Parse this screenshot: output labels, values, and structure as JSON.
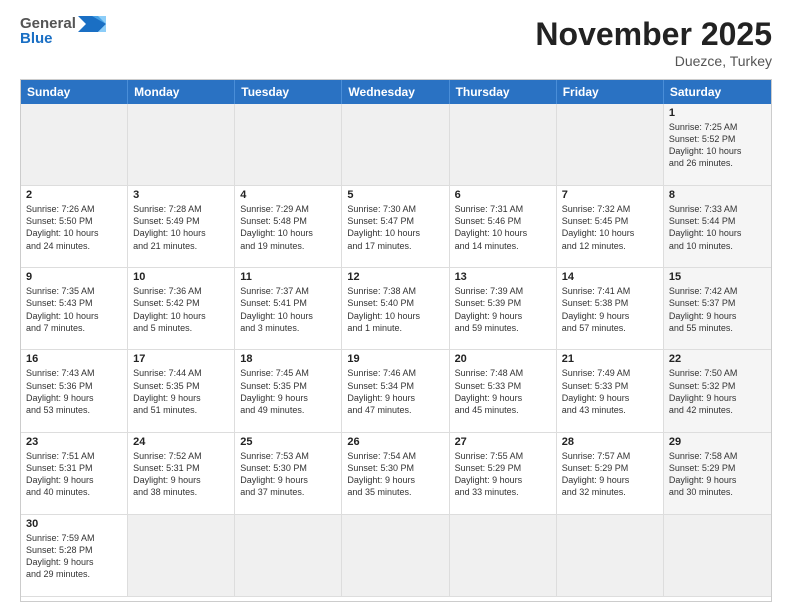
{
  "logo": {
    "general": "General",
    "blue": "Blue"
  },
  "title": "November 2025",
  "subtitle": "Duezce, Turkey",
  "weekdays": [
    "Sunday",
    "Monday",
    "Tuesday",
    "Wednesday",
    "Thursday",
    "Friday",
    "Saturday"
  ],
  "cells": [
    {
      "day": "",
      "info": "",
      "empty": true
    },
    {
      "day": "",
      "info": "",
      "empty": true
    },
    {
      "day": "",
      "info": "",
      "empty": true
    },
    {
      "day": "",
      "info": "",
      "empty": true
    },
    {
      "day": "",
      "info": "",
      "empty": true
    },
    {
      "day": "",
      "info": "",
      "empty": true
    },
    {
      "day": "1",
      "info": "Sunrise: 7:25 AM\nSunset: 5:52 PM\nDaylight: 10 hours\nand 26 minutes.",
      "shaded": true
    },
    {
      "day": "2",
      "info": "Sunrise: 7:26 AM\nSunset: 5:50 PM\nDaylight: 10 hours\nand 24 minutes.",
      "shaded": false
    },
    {
      "day": "3",
      "info": "Sunrise: 7:28 AM\nSunset: 5:49 PM\nDaylight: 10 hours\nand 21 minutes.",
      "shaded": false
    },
    {
      "day": "4",
      "info": "Sunrise: 7:29 AM\nSunset: 5:48 PM\nDaylight: 10 hours\nand 19 minutes.",
      "shaded": false
    },
    {
      "day": "5",
      "info": "Sunrise: 7:30 AM\nSunset: 5:47 PM\nDaylight: 10 hours\nand 17 minutes.",
      "shaded": false
    },
    {
      "day": "6",
      "info": "Sunrise: 7:31 AM\nSunset: 5:46 PM\nDaylight: 10 hours\nand 14 minutes.",
      "shaded": false
    },
    {
      "day": "7",
      "info": "Sunrise: 7:32 AM\nSunset: 5:45 PM\nDaylight: 10 hours\nand 12 minutes.",
      "shaded": false
    },
    {
      "day": "8",
      "info": "Sunrise: 7:33 AM\nSunset: 5:44 PM\nDaylight: 10 hours\nand 10 minutes.",
      "shaded": true
    },
    {
      "day": "9",
      "info": "Sunrise: 7:35 AM\nSunset: 5:43 PM\nDaylight: 10 hours\nand 7 minutes.",
      "shaded": false
    },
    {
      "day": "10",
      "info": "Sunrise: 7:36 AM\nSunset: 5:42 PM\nDaylight: 10 hours\nand 5 minutes.",
      "shaded": false
    },
    {
      "day": "11",
      "info": "Sunrise: 7:37 AM\nSunset: 5:41 PM\nDaylight: 10 hours\nand 3 minutes.",
      "shaded": false
    },
    {
      "day": "12",
      "info": "Sunrise: 7:38 AM\nSunset: 5:40 PM\nDaylight: 10 hours\nand 1 minute.",
      "shaded": false
    },
    {
      "day": "13",
      "info": "Sunrise: 7:39 AM\nSunset: 5:39 PM\nDaylight: 9 hours\nand 59 minutes.",
      "shaded": false
    },
    {
      "day": "14",
      "info": "Sunrise: 7:41 AM\nSunset: 5:38 PM\nDaylight: 9 hours\nand 57 minutes.",
      "shaded": false
    },
    {
      "day": "15",
      "info": "Sunrise: 7:42 AM\nSunset: 5:37 PM\nDaylight: 9 hours\nand 55 minutes.",
      "shaded": true
    },
    {
      "day": "16",
      "info": "Sunrise: 7:43 AM\nSunset: 5:36 PM\nDaylight: 9 hours\nand 53 minutes.",
      "shaded": false
    },
    {
      "day": "17",
      "info": "Sunrise: 7:44 AM\nSunset: 5:35 PM\nDaylight: 9 hours\nand 51 minutes.",
      "shaded": false
    },
    {
      "day": "18",
      "info": "Sunrise: 7:45 AM\nSunset: 5:35 PM\nDaylight: 9 hours\nand 49 minutes.",
      "shaded": false
    },
    {
      "day": "19",
      "info": "Sunrise: 7:46 AM\nSunset: 5:34 PM\nDaylight: 9 hours\nand 47 minutes.",
      "shaded": false
    },
    {
      "day": "20",
      "info": "Sunrise: 7:48 AM\nSunset: 5:33 PM\nDaylight: 9 hours\nand 45 minutes.",
      "shaded": false
    },
    {
      "day": "21",
      "info": "Sunrise: 7:49 AM\nSunset: 5:33 PM\nDaylight: 9 hours\nand 43 minutes.",
      "shaded": false
    },
    {
      "day": "22",
      "info": "Sunrise: 7:50 AM\nSunset: 5:32 PM\nDaylight: 9 hours\nand 42 minutes.",
      "shaded": true
    },
    {
      "day": "23",
      "info": "Sunrise: 7:51 AM\nSunset: 5:31 PM\nDaylight: 9 hours\nand 40 minutes.",
      "shaded": false
    },
    {
      "day": "24",
      "info": "Sunrise: 7:52 AM\nSunset: 5:31 PM\nDaylight: 9 hours\nand 38 minutes.",
      "shaded": false
    },
    {
      "day": "25",
      "info": "Sunrise: 7:53 AM\nSunset: 5:30 PM\nDaylight: 9 hours\nand 37 minutes.",
      "shaded": false
    },
    {
      "day": "26",
      "info": "Sunrise: 7:54 AM\nSunset: 5:30 PM\nDaylight: 9 hours\nand 35 minutes.",
      "shaded": false
    },
    {
      "day": "27",
      "info": "Sunrise: 7:55 AM\nSunset: 5:29 PM\nDaylight: 9 hours\nand 33 minutes.",
      "shaded": false
    },
    {
      "day": "28",
      "info": "Sunrise: 7:57 AM\nSunset: 5:29 PM\nDaylight: 9 hours\nand 32 minutes.",
      "shaded": false
    },
    {
      "day": "29",
      "info": "Sunrise: 7:58 AM\nSunset: 5:29 PM\nDaylight: 9 hours\nand 30 minutes.",
      "shaded": true
    },
    {
      "day": "30",
      "info": "Sunrise: 7:59 AM\nSunset: 5:28 PM\nDaylight: 9 hours\nand 29 minutes.",
      "shaded": false
    },
    {
      "day": "",
      "info": "",
      "empty": true
    },
    {
      "day": "",
      "info": "",
      "empty": true
    },
    {
      "day": "",
      "info": "",
      "empty": true
    },
    {
      "day": "",
      "info": "",
      "empty": true
    },
    {
      "day": "",
      "info": "",
      "empty": true
    },
    {
      "day": "",
      "info": "",
      "empty": true,
      "shaded": true
    }
  ]
}
